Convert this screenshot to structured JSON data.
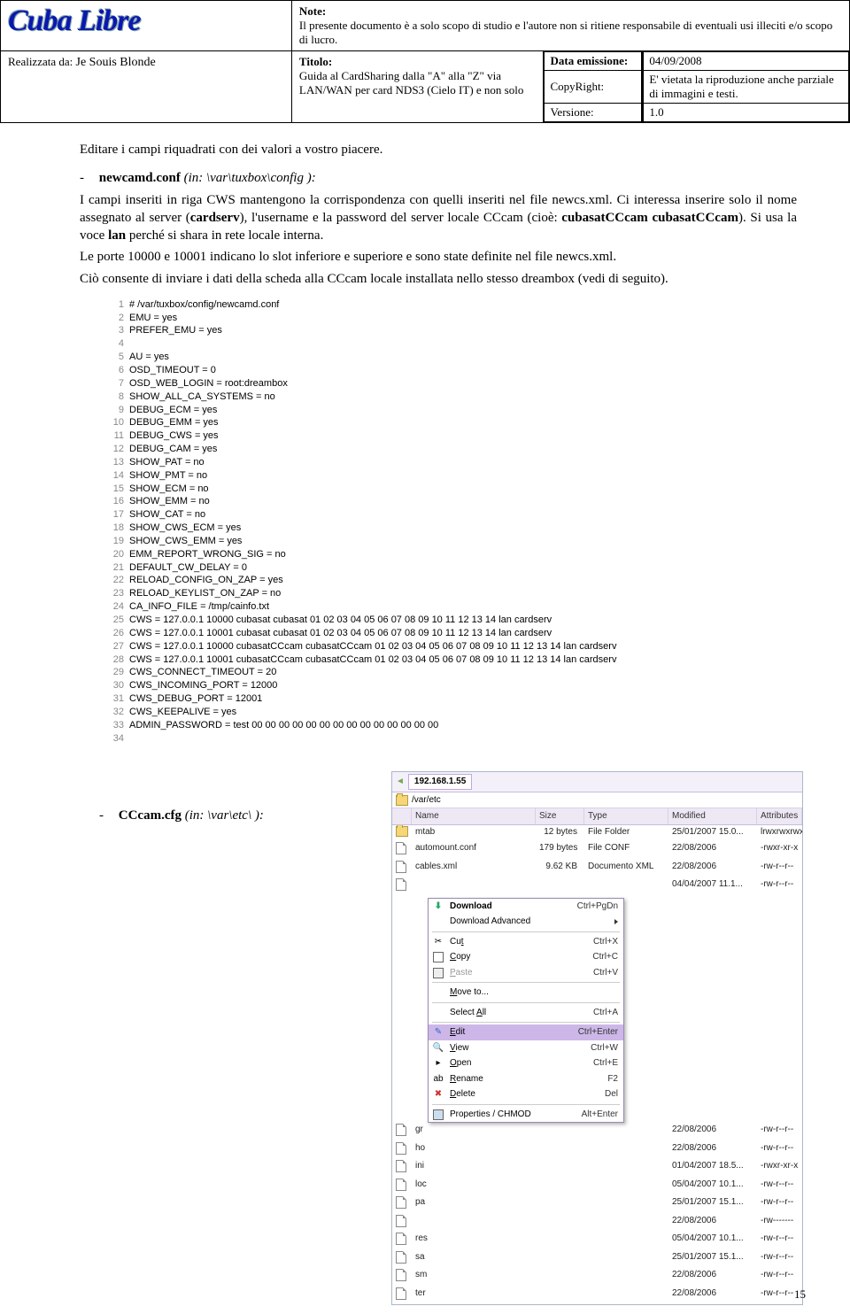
{
  "header": {
    "logo_text": "Cuba Libre",
    "realizzata_label": "Realizzata da: ",
    "realizzata_value": "Je Souis Blonde",
    "note_label": "Note:",
    "note_text": "Il presente documento è a solo scopo di studio e l'autore non si ritiene responsabile di eventuali usi illeciti e/o scopo di lucro.",
    "titolo_label": "Titolo:",
    "titolo_text": "Guida al CardSharing dalla \"A\" alla \"Z\" via LAN/WAN per card NDS3 (Cielo IT) e non solo",
    "data_label": "Data emissione:",
    "data_value": "04/09/2008",
    "copy_label": "CopyRight:",
    "copy_value": "E' vietata la riproduzione anche parziale di immagini e testi.",
    "ver_label": "Versione:",
    "ver_value": "1.0"
  },
  "body": {
    "intro": "Editare i campi riquadrati con dei valori a vostro piacere.",
    "newcamd_title_dash": "-",
    "newcamd_title_bold": "newcamd.conf",
    "newcamd_title_rest": " (in: \\var\\tuxbox\\config ):",
    "para1": "I campi inseriti in riga CWS mantengono la corrispondenza con quelli inseriti nel file newcs.xml. Ci interessa inserire solo il nome assegnato al server (cardserv), l'username e la password del server locale CCcam (cioè: cubasatCCcam cubasatCCcam). Si usa la voce lan perché si shara in rete locale interna.",
    "para2": "Le porte 10000 e 10001 indicano lo slot inferiore e superiore e sono state definite nel file newcs.xml.",
    "para3": "Ciò consente di inviare i dati della scheda alla CCcam locale installata nello stesso dreambox (vedi di seguito).",
    "ccam_title_dash": "-",
    "ccam_title_bold": "CCcam.cfg",
    "ccam_title_rest": " (in: \\var\\etc\\ ):"
  },
  "code": [
    "# /var/tuxbox/config/newcamd.conf",
    "EMU = yes",
    "PREFER_EMU = yes",
    "",
    "AU = yes",
    "OSD_TIMEOUT = 0",
    "OSD_WEB_LOGIN = root:dreambox",
    "SHOW_ALL_CA_SYSTEMS = no",
    "DEBUG_ECM = yes",
    "DEBUG_EMM = yes",
    "DEBUG_CWS = yes",
    "DEBUG_CAM = yes",
    "SHOW_PAT = no",
    "SHOW_PMT = no",
    "SHOW_ECM = no",
    "SHOW_EMM = no",
    "SHOW_CAT = no",
    "SHOW_CWS_ECM = yes",
    "SHOW_CWS_EMM = yes",
    "EMM_REPORT_WRONG_SIG = no",
    "DEFAULT_CW_DELAY = 0",
    "RELOAD_CONFIG_ON_ZAP = yes",
    "RELOAD_KEYLIST_ON_ZAP = no",
    "CA_INFO_FILE = /tmp/cainfo.txt",
    "CWS = 127.0.0.1 10000 cubasat cubasat 01 02 03 04 05 06 07 08 09 10 11 12 13 14 lan cardserv",
    "CWS = 127.0.0.1 10001 cubasat cubasat 01 02 03 04 05 06 07 08 09 10 11 12 13 14 lan cardserv",
    "CWS = 127.0.0.1 10000 cubasatCCcam cubasatCCcam 01 02 03 04 05 06 07 08 09 10 11 12 13 14 lan cardserv",
    "CWS = 127.0.0.1 10001 cubasatCCcam cubasatCCcam 01 02 03 04 05 06 07 08 09 10 11 12 13 14 lan cardserv",
    "CWS_CONNECT_TIMEOUT = 20",
    "CWS_INCOMING_PORT = 12000",
    "CWS_DEBUG_PORT = 12001",
    "CWS_KEEPALIVE = yes",
    "ADMIN_PASSWORD = test 00 00 00 00 00 00 00 00 00 00 00 00 00 00",
    ""
  ],
  "browser": {
    "address": "192.168.1.55",
    "path": "/var/etc",
    "cols": {
      "c0": "",
      "c1": "Name",
      "c2": "Size",
      "c3": "Type",
      "c4": "Modified",
      "c5": "Attributes"
    },
    "rows": [
      {
        "icon": "folder",
        "name": "mtab",
        "size": "12 bytes",
        "type": "File Folder",
        "mod": "25/01/2007 15.0...",
        "attr": "lrwxrwxrwx"
      },
      {
        "icon": "file",
        "name": "automount.conf",
        "size": "179 bytes",
        "type": "File CONF",
        "mod": "22/08/2006",
        "attr": "-rwxr-xr-x"
      },
      {
        "icon": "file",
        "name": "cables.xml",
        "size": "9.62 KB",
        "type": "Documento XML",
        "mod": "22/08/2006",
        "attr": "-rw-r--r--"
      },
      {
        "icon": "file",
        "name": "",
        "size": "",
        "type": "",
        "mod": "04/04/2007 11.1...",
        "attr": "-rw-r--r--"
      },
      {
        "icon": "file",
        "name": "gr",
        "size": "",
        "type": "",
        "mod": "22/08/2006",
        "attr": "-rw-r--r--"
      },
      {
        "icon": "file",
        "name": "ho",
        "size": "",
        "type": "",
        "mod": "22/08/2006",
        "attr": "-rw-r--r--"
      },
      {
        "icon": "file",
        "name": "ini",
        "size": "",
        "type": "",
        "mod": "01/04/2007 18.5...",
        "attr": "-rwxr-xr-x"
      },
      {
        "icon": "file",
        "name": "loc",
        "size": "",
        "type": "",
        "mod": "05/04/2007 10.1...",
        "attr": "-rw-r--r--"
      },
      {
        "icon": "file",
        "name": "pa",
        "size": "",
        "type": "",
        "mod": "25/01/2007 15.1...",
        "attr": "-rw-r--r--"
      },
      {
        "icon": "file",
        "name": "",
        "size": "",
        "type": "",
        "mod": "22/08/2006",
        "attr": "-rw-------"
      },
      {
        "icon": "file",
        "name": "res",
        "size": "",
        "type": "",
        "mod": "05/04/2007 10.1...",
        "attr": "-rw-r--r--"
      },
      {
        "icon": "file",
        "name": "sa",
        "size": "",
        "type": "",
        "mod": "25/01/2007 15.1...",
        "attr": "-rw-r--r--"
      },
      {
        "icon": "file",
        "name": "sm",
        "size": "",
        "type": "",
        "mod": "22/08/2006",
        "attr": "-rw-r--r--"
      },
      {
        "icon": "file",
        "name": "ter",
        "size": "",
        "type": "",
        "mod": "22/08/2006",
        "attr": "-rw-r--r--"
      }
    ],
    "menu": [
      {
        "icon": "dl",
        "label": "Download",
        "shortcut": "Ctrl+PgDn",
        "bold": true
      },
      {
        "icon": "",
        "label": "Download Advanced",
        "shortcut": "",
        "sub": true
      },
      {
        "sep": true
      },
      {
        "icon": "cut",
        "label": "Cut",
        "shortcut": "Ctrl+X",
        "u": "t"
      },
      {
        "icon": "copy",
        "label": "Copy",
        "shortcut": "Ctrl+C",
        "u": "C"
      },
      {
        "icon": "paste",
        "label": "Paste",
        "shortcut": "Ctrl+V",
        "dis": true,
        "u": "P"
      },
      {
        "sep": true
      },
      {
        "icon": "",
        "label": "Move to...",
        "shortcut": "",
        "u": "M"
      },
      {
        "sep": true
      },
      {
        "icon": "",
        "label": "Select All",
        "shortcut": "Ctrl+A",
        "u": "A"
      },
      {
        "sep": true
      },
      {
        "icon": "edit",
        "label": "Edit",
        "shortcut": "Ctrl+Enter",
        "sel": true,
        "u": "E"
      },
      {
        "icon": "view",
        "label": "View",
        "shortcut": "Ctrl+W",
        "u": "V"
      },
      {
        "icon": "open",
        "label": "Open",
        "shortcut": "Ctrl+E",
        "u": "O"
      },
      {
        "icon": "ren",
        "label": "Rename",
        "shortcut": "F2",
        "u": "R"
      },
      {
        "icon": "del",
        "label": "Delete",
        "shortcut": "Del",
        "u": "D"
      },
      {
        "sep": true
      },
      {
        "icon": "prop",
        "label": "Properties / CHMOD",
        "shortcut": "Alt+Enter"
      }
    ]
  },
  "page_number": "15"
}
